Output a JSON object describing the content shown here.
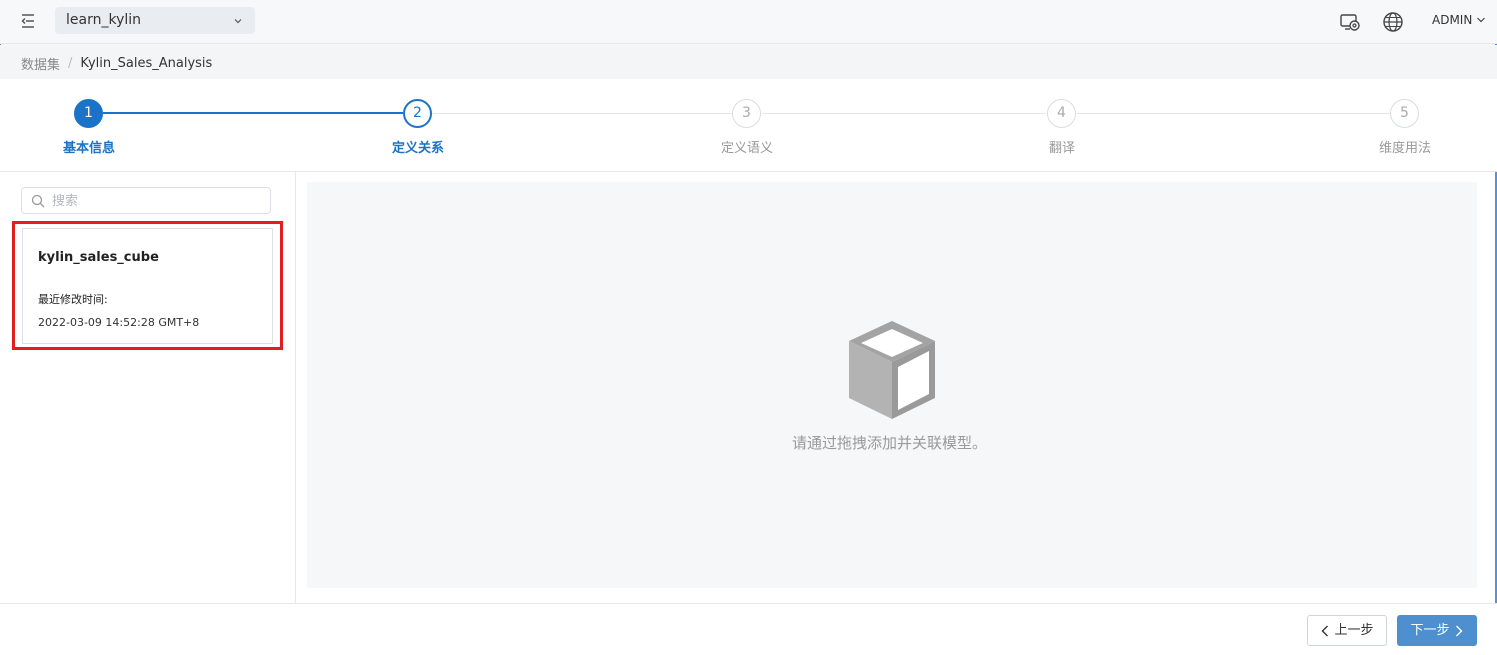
{
  "header": {
    "project": "learn_kylin",
    "user": "ADMIN"
  },
  "breadcrumb": {
    "root": "数据集",
    "separator": "/",
    "current": "Kylin_Sales_Analysis"
  },
  "steps": [
    {
      "num": "1",
      "label": "基本信息",
      "state": "done"
    },
    {
      "num": "2",
      "label": "定义关系",
      "state": "active"
    },
    {
      "num": "3",
      "label": "定义语义",
      "state": "pending"
    },
    {
      "num": "4",
      "label": "翻译",
      "state": "pending"
    },
    {
      "num": "5",
      "label": "维度用法",
      "state": "pending"
    }
  ],
  "sidebar": {
    "search_placeholder": "搜索",
    "models": [
      {
        "name": "kylin_sales_cube",
        "time_label": "最近修改时间:",
        "time": "2022-03-09 14:52:28 GMT+8"
      }
    ]
  },
  "canvas": {
    "empty_text": "请通过拖拽添加并关联模型。"
  },
  "footer": {
    "prev_label": "上一步",
    "next_label": "下一步"
  },
  "colors": {
    "primary": "#1a73c9",
    "highlight_border": "#e02020",
    "next_button": "#4d8fcf"
  },
  "icons": {
    "menu": "menu-fold-icon",
    "dashboard": "monitor-settings-icon",
    "language": "globe-icon",
    "empty": "cube-icon"
  }
}
